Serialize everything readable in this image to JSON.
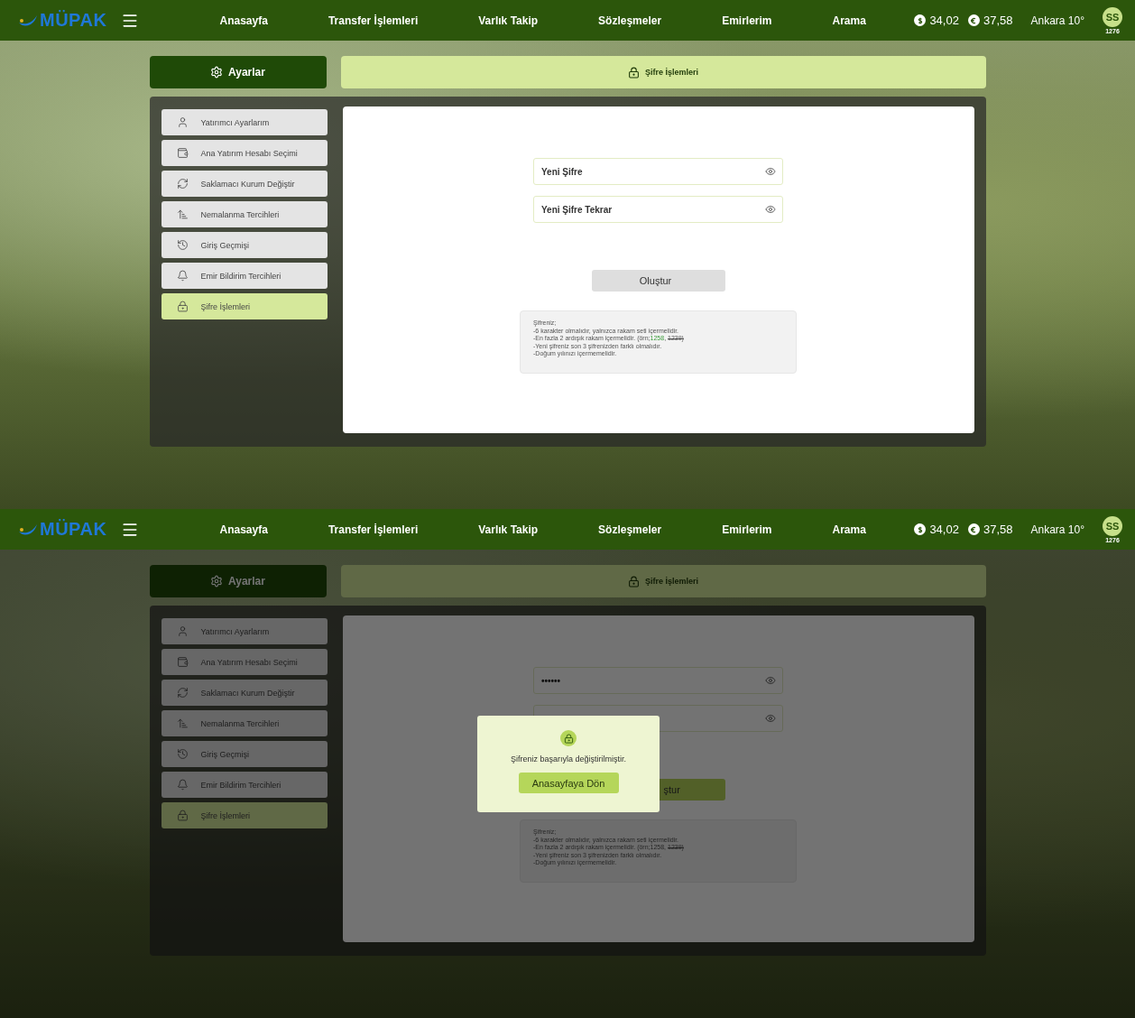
{
  "screens": [
    {
      "nav": {
        "logo": "MÜPAK",
        "items": [
          "Anasayfa",
          "Transfer İşlemleri",
          "Varlık Takip",
          "Sözleşmeler",
          "Emirlerim",
          "Arama"
        ],
        "rates": [
          {
            "kind": "usd",
            "value": "34,02"
          },
          {
            "kind": "eur",
            "value": "37,58"
          }
        ],
        "weather": "Ankara 10°",
        "avatar": "SS",
        "user_no": "1276"
      },
      "settings_title": "Ayarlar",
      "page_title": "Şifre İşlemleri",
      "menu": [
        {
          "label": "Yatırımcı Ayarlarım",
          "selected": false
        },
        {
          "label": "Ana Yatırım Hesabı Seçimi",
          "selected": false
        },
        {
          "label": "Saklamacı Kurum Değiştir",
          "selected": false
        },
        {
          "label": "Nemalanma Tercihleri",
          "selected": false
        },
        {
          "label": "Giriş Geçmişi",
          "selected": false
        },
        {
          "label": "Emir Bildirim Tercihleri",
          "selected": false
        },
        {
          "label": "Şifre İşlemleri",
          "selected": true
        }
      ],
      "fields": [
        {
          "kind": "password",
          "placeholder": "Yeni Şifre"
        },
        {
          "kind": "password",
          "placeholder": "Yeni Şifre Tekrar"
        }
      ],
      "submit": "Oluştur",
      "rules": [
        [
          {
            "kind": "plain",
            "text": "Şifreniz;"
          }
        ],
        [
          {
            "kind": "plain",
            "text": "-6 karakter olmalıdır, yalnızca rakam seti içermelidir."
          }
        ],
        [
          {
            "kind": "plain",
            "text": "-En fazla 2 ardışık rakam içermelidir. (örn;"
          },
          {
            "kind": "valid",
            "text": "1258"
          },
          {
            "kind": "plain",
            "text": ", "
          },
          {
            "kind": "invalid",
            "text": "1239)"
          }
        ],
        [
          {
            "kind": "plain",
            "text": "-Yeni şifreniz son 3 şifrenizden farklı olmalıdır."
          }
        ],
        [
          {
            "kind": "plain",
            "text": "-Doğum yılınızı içermemelidir."
          }
        ]
      ]
    },
    {
      "nav": {
        "logo": "MÜPAK",
        "items": [
          "Anasayfa",
          "Transfer İşlemleri",
          "Varlık Takip",
          "Sözleşmeler",
          "Emirlerim",
          "Arama"
        ],
        "rates": [
          {
            "kind": "usd",
            "value": "34,02"
          },
          {
            "kind": "eur",
            "value": "37,58"
          }
        ],
        "weather": "Ankara 10°",
        "avatar": "SS",
        "user_no": "1276"
      },
      "settings_title": "Ayarlar",
      "page_title": "Şifre İşlemleri",
      "menu": [
        {
          "label": "Yatırımcı Ayarlarım",
          "selected": false
        },
        {
          "label": "Ana Yatırım Hesabı Seçimi",
          "selected": false
        },
        {
          "label": "Saklamacı Kurum Değiştir",
          "selected": false
        },
        {
          "label": "Nemalanma Tercihleri",
          "selected": false
        },
        {
          "label": "Giriş Geçmişi",
          "selected": false
        },
        {
          "label": "Emir Bildirim Tercihleri",
          "selected": false
        },
        {
          "label": "Şifre İşlemleri",
          "selected": true
        }
      ],
      "fields": [
        {
          "kind": "password",
          "value": "••••••"
        },
        {
          "kind": "password"
        }
      ],
      "submit": "ştur",
      "rules": [
        [
          {
            "kind": "plain",
            "text": "Şifreniz;"
          }
        ],
        [
          {
            "kind": "plain",
            "text": "-6 karakter olmalıdır, yalnızca rakam seti içermelidir."
          }
        ],
        [
          {
            "kind": "plain",
            "text": "-En fazla 2 ardışık rakam içermelidir. (örn;1258, "
          },
          {
            "kind": "invalid",
            "text": "1239)"
          }
        ],
        [
          {
            "kind": "plain",
            "text": "-Yeni şifreniz son 3 şifrenizden farklı olmalıdır."
          }
        ],
        [
          {
            "kind": "plain",
            "text": "-Doğum yılınızı içermemelidir."
          }
        ]
      ],
      "modal": {
        "message": "Şifreniz başarıyla değiştirilmiştir.",
        "button": "Anasayfaya Dön"
      }
    }
  ]
}
